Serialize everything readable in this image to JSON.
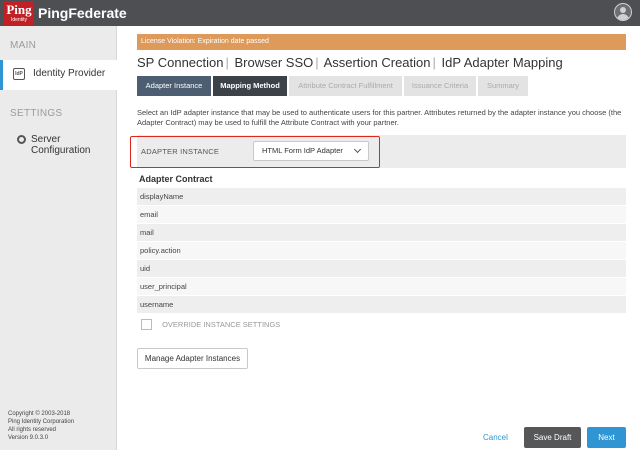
{
  "header": {
    "logo_text": "Ping",
    "logo_subtext": "Identity",
    "product_name": "PingFederate"
  },
  "sidebar": {
    "main_heading": "MAIN",
    "items_main": [
      {
        "label": "Identity Provider",
        "icon": "idp-icon",
        "active": true
      }
    ],
    "settings_heading": "SETTINGS",
    "items_settings": [
      {
        "label": "Server Configuration",
        "icon": "gear-icon",
        "active": false
      }
    ],
    "copyright": [
      "Copyright © 2003-2018",
      "Ping Identity Corporation",
      "All rights reserved",
      "Version 9.0.3.0"
    ]
  },
  "banner": {
    "text": "License Violation: Expiration date passed",
    "color": "#dd9a5b"
  },
  "breadcrumb": [
    "SP Connection",
    "Browser SSO",
    "Assertion Creation",
    "IdP Adapter Mapping"
  ],
  "tabs": [
    {
      "label": "Adapter Instance",
      "state": "done"
    },
    {
      "label": "Mapping Method",
      "state": "current"
    },
    {
      "label": "Attribute Contract Fulfillment",
      "state": "todo"
    },
    {
      "label": "Issuance Criteria",
      "state": "todo"
    },
    {
      "label": "Summary",
      "state": "todo"
    }
  ],
  "description": "Select an IdP adapter instance that may be used to authenticate users for this partner. Attributes returned by the adapter instance you choose (the Adapter Contract) may be used to fulfill the Attribute Contract with your partner.",
  "adapter_instance": {
    "label": "ADAPTER INSTANCE",
    "selected": "HTML Form IdP Adapter"
  },
  "adapter_contract": {
    "title": "Adapter Contract",
    "attributes": [
      "displayName",
      "email",
      "mail",
      "policy.action",
      "uid",
      "user_principal",
      "username"
    ]
  },
  "override": {
    "label": "OVERRIDE INSTANCE SETTINGS",
    "checked": false
  },
  "buttons": {
    "manage": "Manage Adapter Instances",
    "cancel": "Cancel",
    "save_draft": "Save Draft",
    "next": "Next"
  },
  "colors": {
    "accent": "#2f96d3",
    "tab_done": "#4d5e73",
    "tab_current": "#3c4248",
    "highlight": "#e1251b",
    "logo": "#c22027"
  }
}
